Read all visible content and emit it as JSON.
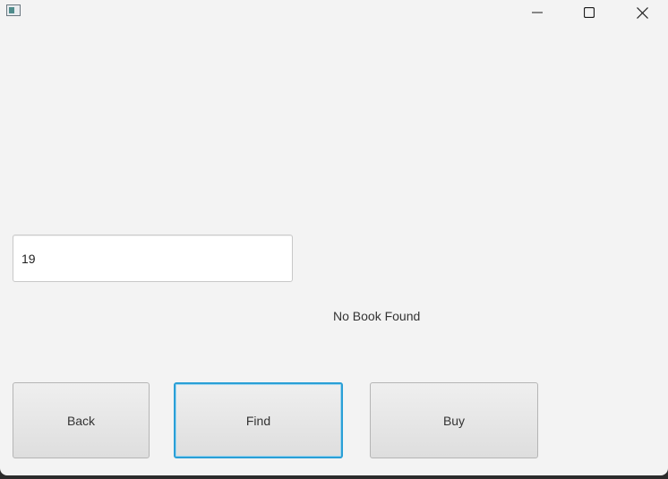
{
  "titlebar": {
    "icon": "app-window-icon",
    "minimize_icon": "minimize-icon",
    "maximize_icon": "maximize-icon",
    "close_icon": "close-icon"
  },
  "search": {
    "value": "19"
  },
  "status": {
    "text": "No Book Found"
  },
  "buttons": {
    "back_label": "Back",
    "find_label": "Find",
    "buy_label": "Buy"
  },
  "colors": {
    "window_bg": "#f3f3f3",
    "focus_border": "#2a9fd6"
  }
}
